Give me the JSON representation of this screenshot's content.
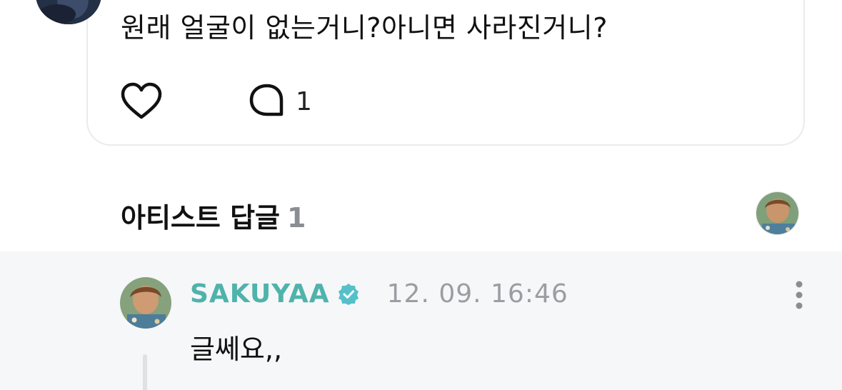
{
  "post": {
    "text": "원래 얼굴이 없는거니?아니면 사라진거니?",
    "comment_count": "1"
  },
  "artist_reply": {
    "header_label": "아티스트 답글",
    "header_count": "1"
  },
  "reply": {
    "author": "SAKUYAA",
    "timestamp": "12. 09. 16:46",
    "text": "글쎄요,,"
  },
  "icons": {
    "like": "heart-icon",
    "comment": "speech-bubble-icon",
    "verified": "verified-badge-icon",
    "more": "more-vertical-icon"
  },
  "colors": {
    "author_name": "#4fb3ab",
    "verified_badge": "#55c0c9",
    "reply_background": "#f6f7f9",
    "muted_text": "#9a9da2"
  }
}
